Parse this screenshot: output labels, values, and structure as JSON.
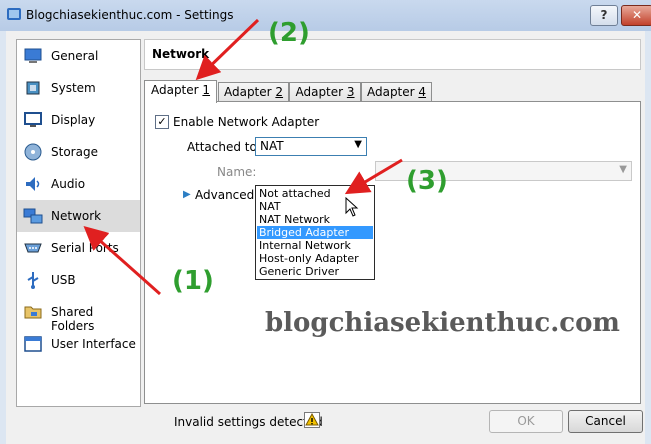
{
  "window": {
    "title": "Blogchiasekienthuc.com - Settings",
    "help_label": "?",
    "close_label": "✕"
  },
  "sidebar": {
    "items": [
      {
        "label": "General",
        "icon": "general-icon"
      },
      {
        "label": "System",
        "icon": "system-icon"
      },
      {
        "label": "Display",
        "icon": "display-icon"
      },
      {
        "label": "Storage",
        "icon": "storage-icon"
      },
      {
        "label": "Audio",
        "icon": "audio-icon"
      },
      {
        "label": "Network",
        "icon": "network-icon",
        "selected": true
      },
      {
        "label": "Serial Ports",
        "icon": "serial-ports-icon"
      },
      {
        "label": "USB",
        "icon": "usb-icon"
      },
      {
        "label": "Shared Folders",
        "icon": "shared-folders-icon"
      },
      {
        "label": "User Interface",
        "icon": "user-interface-icon"
      }
    ]
  },
  "header": {
    "title": "Network"
  },
  "tabs": [
    {
      "prefix": "Adapter ",
      "key": "1",
      "active": true
    },
    {
      "prefix": "Adapter ",
      "key": "2"
    },
    {
      "prefix": "Adapter ",
      "key": "3"
    },
    {
      "prefix": "Adapter ",
      "key": "4"
    }
  ],
  "adapter": {
    "enable_label": "Enable Network Adapter",
    "enable_checked": "✓",
    "attached_label": "Attached to:",
    "attached_value": "NAT",
    "name_label": "Name:",
    "advanced_label": "Advanced"
  },
  "dropdown": {
    "options": [
      "Not attached",
      "NAT",
      "NAT Network",
      "Bridged Adapter",
      "Internal Network",
      "Host-only Adapter",
      "Generic Driver"
    ],
    "highlighted": "Bridged Adapter"
  },
  "footer": {
    "invalid_text": "Invalid settings detected",
    "ok_label": "OK",
    "cancel_label": "Cancel"
  },
  "annotations": {
    "step1": "(1)",
    "step2": "(2)",
    "step3": "(3)",
    "watermark": "blogchiasekienthuc.com",
    "color": "#2f9e2f",
    "arrow_color": "#e02020"
  }
}
